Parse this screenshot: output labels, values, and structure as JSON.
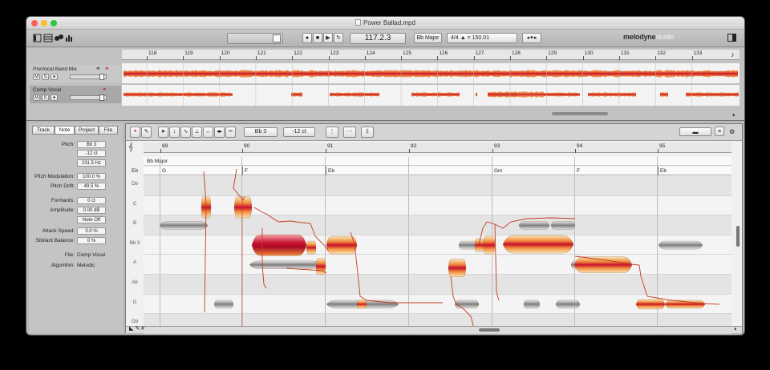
{
  "window": {
    "title": "Power Ballad.mpd"
  },
  "toolbar": {
    "position": "117.2.3",
    "key": "Bb Major",
    "meter": "4/4",
    "tempo": "150.01",
    "tempo_prefix": "=",
    "logo_main": "melodyne",
    "logo_sub": "studio"
  },
  "arrangement": {
    "bars": [
      "118",
      "119",
      "120",
      "121",
      "122",
      "123",
      "124",
      "125",
      "126",
      "127",
      "128",
      "129",
      "130",
      "131",
      "132",
      "133"
    ],
    "tracks": [
      {
        "name": "PreVocal Band Mix",
        "mute": "M",
        "solo": "S"
      },
      {
        "name": "Comp Vocal",
        "mute": "M",
        "solo": "S"
      }
    ]
  },
  "inspector": {
    "tabs": [
      "Track",
      "Note",
      "Project",
      "File"
    ],
    "active_tab": "Note",
    "rows": [
      {
        "label": "Pitch:",
        "value": "Bb 3"
      },
      {
        "label": "",
        "value": "-12 ct"
      },
      {
        "label": "",
        "value": "231.5 Hz"
      },
      {
        "label": "Pitch Modulation:",
        "value": "100.0 %"
      },
      {
        "label": "Pitch Drift:",
        "value": "49.5 %"
      },
      {
        "label": "Formants:",
        "value": "0 ct"
      },
      {
        "label": "Amplitude:",
        "value": "0.00 dB"
      },
      {
        "label": "",
        "value": "Note Off"
      },
      {
        "label": "Attack Speed:",
        "value": "0.0 %"
      },
      {
        "label": "Sibilant Balance:",
        "value": "0 %"
      }
    ],
    "file_label": "File:",
    "file_value": "Comp Vocal",
    "algorithm_label": "Algorithm:",
    "algorithm_value": "Melodic"
  },
  "editor": {
    "pitch_field": "Bb 3",
    "cent_field": "-12 ct",
    "bars": [
      "89",
      "90",
      "91",
      "92",
      "93",
      "94",
      "95"
    ],
    "scale_label": "Bb Major",
    "chords": [
      "Eb",
      "G",
      "F",
      "Eb",
      "Gm",
      "F",
      "Eb"
    ],
    "pitches": [
      "Db",
      "C",
      "B",
      "Bb 3",
      "A",
      "Ab",
      "G",
      "Gb"
    ]
  },
  "colors": {
    "note_hot": "#c8102e",
    "note_mid": "#f08a3c",
    "note_pale": "#fbe6b4",
    "note_grey": "#9a9a9a",
    "pitch_line": "#c23b22"
  }
}
